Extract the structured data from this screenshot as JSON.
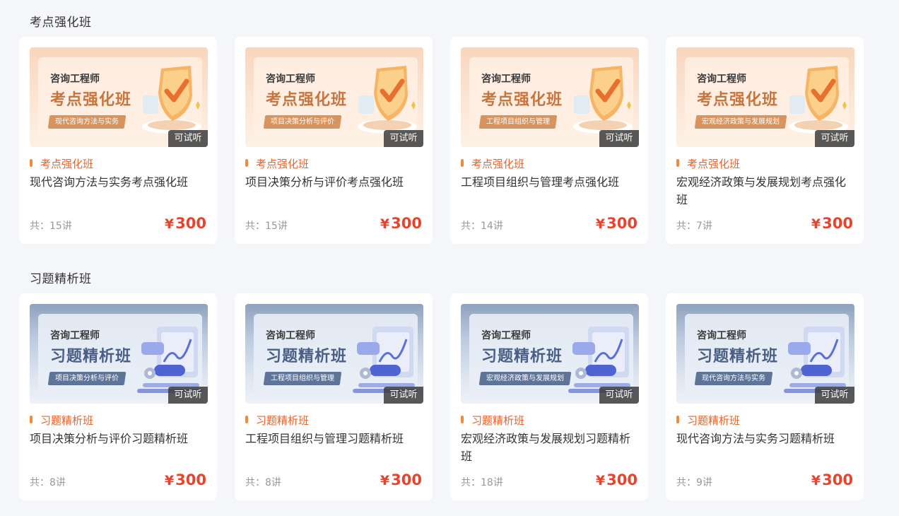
{
  "sections": [
    {
      "title": "考点强化班",
      "theme": "orange",
      "courses": [
        {
          "banner_small": "咨询工程师",
          "banner_big": "考点强化班",
          "banner_pill": "现代咨询方法与实务",
          "trial": "可试听",
          "tag": "考点强化班",
          "title": "现代咨询方法与实务考点强化班",
          "lessons": "共：15讲",
          "currency": "¥",
          "price": "300"
        },
        {
          "banner_small": "咨询工程师",
          "banner_big": "考点强化班",
          "banner_pill": "项目决策分析与评价",
          "trial": "可试听",
          "tag": "考点强化班",
          "title": "项目决策分析与评价考点强化班",
          "lessons": "共：15讲",
          "currency": "¥",
          "price": "300"
        },
        {
          "banner_small": "咨询工程师",
          "banner_big": "考点强化班",
          "banner_pill": "工程项目组织与管理",
          "trial": "可试听",
          "tag": "考点强化班",
          "title": "工程项目组织与管理考点强化班",
          "lessons": "共：14讲",
          "currency": "¥",
          "price": "300"
        },
        {
          "banner_small": "咨询工程师",
          "banner_big": "考点强化班",
          "banner_pill": "宏观经济政策与发展规划",
          "trial": "可试听",
          "tag": "考点强化班",
          "title": "宏观经济政策与发展规划考点强化班",
          "lessons": "共：7讲",
          "currency": "¥",
          "price": "300"
        }
      ]
    },
    {
      "title": "习题精析班",
      "theme": "blue",
      "courses": [
        {
          "banner_small": "咨询工程师",
          "banner_big": "习题精析班",
          "banner_pill": "项目决策分析与评价",
          "trial": "可试听",
          "tag": "习题精析班",
          "title": "项目决策分析与评价习题精析班",
          "lessons": "共：8讲",
          "currency": "¥",
          "price": "300"
        },
        {
          "banner_small": "咨询工程师",
          "banner_big": "习题精析班",
          "banner_pill": "工程项目组织与管理",
          "trial": "可试听",
          "tag": "习题精析班",
          "title": "工程项目组织与管理习题精析班",
          "lessons": "共：8讲",
          "currency": "¥",
          "price": "300"
        },
        {
          "banner_small": "咨询工程师",
          "banner_big": "习题精析班",
          "banner_pill": "宏观经济政策与发展规划",
          "trial": "可试听",
          "tag": "习题精析班",
          "title": "宏观经济政策与发展规划习题精析班",
          "lessons": "共：18讲",
          "currency": "¥",
          "price": "300"
        },
        {
          "banner_small": "咨询工程师",
          "banner_big": "习题精析班",
          "banner_pill": "现代咨询方法与实务",
          "trial": "可试听",
          "tag": "习题精析班",
          "title": "现代咨询方法与实务习题精析班",
          "lessons": "共：9讲",
          "currency": "¥",
          "price": "300"
        }
      ]
    }
  ],
  "colors": {
    "accent_orange": "#e8642c",
    "price_red": "#e8432d",
    "page_bg": "#f5f6fa"
  }
}
